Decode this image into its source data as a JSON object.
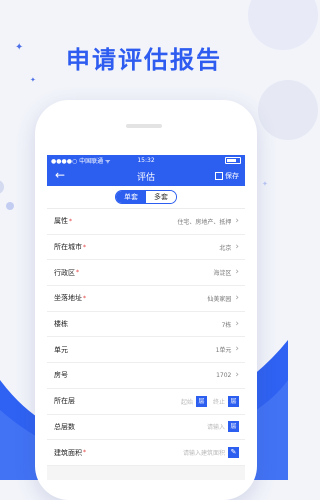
{
  "headline": "申请评估报告",
  "colors": {
    "accent": "#2c5ef0",
    "headline": "#2e5cf0",
    "required": "#e23a3a"
  },
  "status": {
    "carrier": "●●●●○ 中国联通 ᯤ",
    "time": "15:32"
  },
  "nav": {
    "title": "评估",
    "save": "保存"
  },
  "segments": [
    "单套",
    "多套"
  ],
  "rows": [
    {
      "label": "属性",
      "required": true,
      "value": "住宅、房地产、抵押"
    },
    {
      "label": "所在城市",
      "required": true,
      "value": "北京"
    },
    {
      "label": "行政区",
      "required": true,
      "value": "海淀区"
    },
    {
      "label": "坐落地址",
      "required": true,
      "value": "仙美家园"
    },
    {
      "label": "楼栋",
      "required": false,
      "value": "7栋"
    },
    {
      "label": "单元",
      "required": false,
      "value": "1单元"
    },
    {
      "label": "房号",
      "required": false,
      "value": "1702"
    },
    {
      "label": "所在层",
      "required": false,
      "from_placeholder": "起始",
      "unit1": "层",
      "to_placeholder": "终止",
      "unit2": "层"
    },
    {
      "label": "总层数",
      "required": false,
      "placeholder": "请输入",
      "unit": "层"
    },
    {
      "label": "建筑面积",
      "required": true,
      "placeholder": "请输入建筑面积"
    }
  ]
}
